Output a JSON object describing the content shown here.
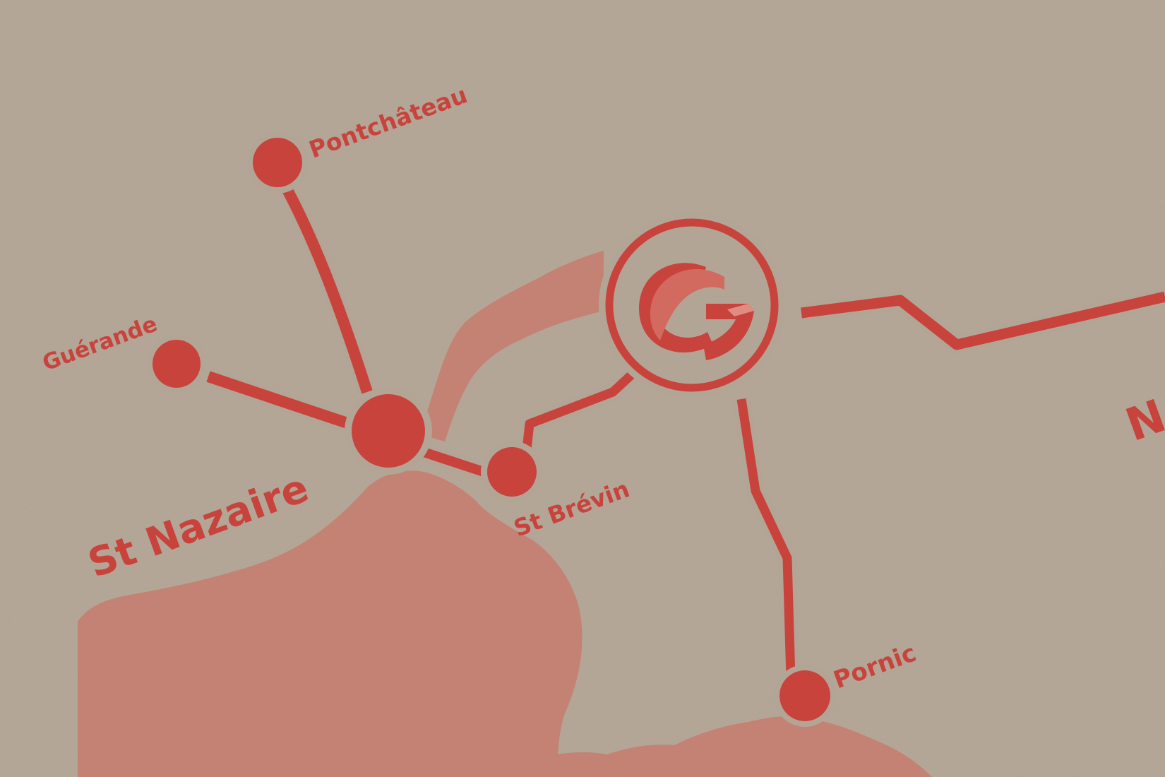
{
  "map": {
    "colors": {
      "paper": "#b3a595",
      "ink": "#c9433d",
      "land": "#c48274"
    },
    "hub": {
      "icon": "company-logo-c-icon"
    },
    "towns": {
      "pontchateau": "Pontchâteau",
      "guerande": "Guérande",
      "st_nazaire": "St Nazaire",
      "st_brevin": "St Brévin",
      "pornic": "Pornic"
    },
    "edge_text": "N"
  }
}
